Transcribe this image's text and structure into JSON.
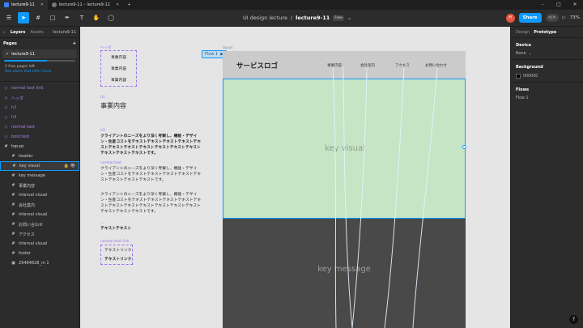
{
  "window": {
    "tabs": [
      {
        "label": "lecture9-11",
        "active": true
      },
      {
        "label": "lecture9-11 – lecture9-11",
        "active": false
      }
    ],
    "new_tab": "+",
    "controls": [
      "–",
      "□",
      "✕"
    ]
  },
  "toolbar": {
    "breadcrumb": "UI design lecture",
    "separator": "/",
    "file_name": "lecture9-11",
    "badge": "Free",
    "avatar_initials": "H",
    "share_label": "Share",
    "dev_label": "</>",
    "play_label": "▷",
    "zoom": "73%"
  },
  "left_panel": {
    "tabs": [
      "Layers",
      "Assets"
    ],
    "current_page_picker": "lecture9-11",
    "pages_heading": "Pages",
    "add_page": "+",
    "pages": [
      "lecture9-11"
    ],
    "free_pages_note": "2 free pages left",
    "upgrade_link": "See plans that offer more",
    "layers": [
      {
        "label": "normal text link",
        "type": "component"
      },
      {
        "label": "ヘッダ",
        "type": "component"
      },
      {
        "label": "h2",
        "type": "component"
      },
      {
        "label": "h3",
        "type": "component"
      },
      {
        "label": "normal text",
        "type": "component"
      },
      {
        "label": "bold text",
        "type": "component"
      },
      {
        "label": "top-pc",
        "type": "frame"
      }
    ],
    "children": [
      {
        "label": "header"
      },
      {
        "label": "key visual",
        "selected": true
      },
      {
        "label": "key message"
      },
      {
        "label": "事業内容"
      },
      {
        "label": "interval visual"
      },
      {
        "label": "会社案内"
      },
      {
        "label": "interval visual"
      },
      {
        "label": "お問い合わせ"
      },
      {
        "label": "アクセス"
      },
      {
        "label": "interval visual"
      },
      {
        "label": "footer"
      },
      {
        "label": "29484828_m 1"
      }
    ]
  },
  "right_panel": {
    "tabs": [
      "Design",
      "Prototype"
    ],
    "device_heading": "Device",
    "device_value": "None",
    "background_heading": "Background",
    "background_value": "000000",
    "flows_heading": "Flows",
    "flows_value": "Flow 1",
    "help": "?"
  },
  "canvas": {
    "components": {
      "header_label": "ヘッダ",
      "header_items": [
        "事業内容",
        "事業内容",
        "事業内容"
      ],
      "h2_label": "h2",
      "h2_text": "事業内容",
      "h3_label": "h3",
      "h3_text": "クライアントのニーズをより深く考察し、機能・デザイン・生産コストをテキストテキストテキストテキストテキストテキストテキストテキストテキストテキストテキストテキストテキストテキストです。",
      "normal_label": "normal text",
      "normal_text_1": "クライアントのニーズをより深く考察し、機能・デザイン・生産コストをテキストテキストテキストテキストテキストテキストテキストテキストです。",
      "normal_text_2": "クライアントのニーズをより深く考察し、機能・デザイン・生産コストをテキストテキストテキストテキストテキストテキストテキストテキストテキストテキストテキストテキストテキストテキストです。",
      "bold_label": "...",
      "bold_text": "テキストテキスト",
      "link_label": "normal text link",
      "link_items": [
        "テキストリンク",
        "テキストリンク"
      ]
    },
    "frame_name": "top-pc",
    "flow_label": "Flow 1",
    "site": {
      "logo": "サービスロゴ",
      "nav": [
        "事業内容",
        "会社案内",
        "アクセス",
        "お問い合わせ"
      ],
      "key_visual": "key visual",
      "key_message": "key message"
    }
  }
}
